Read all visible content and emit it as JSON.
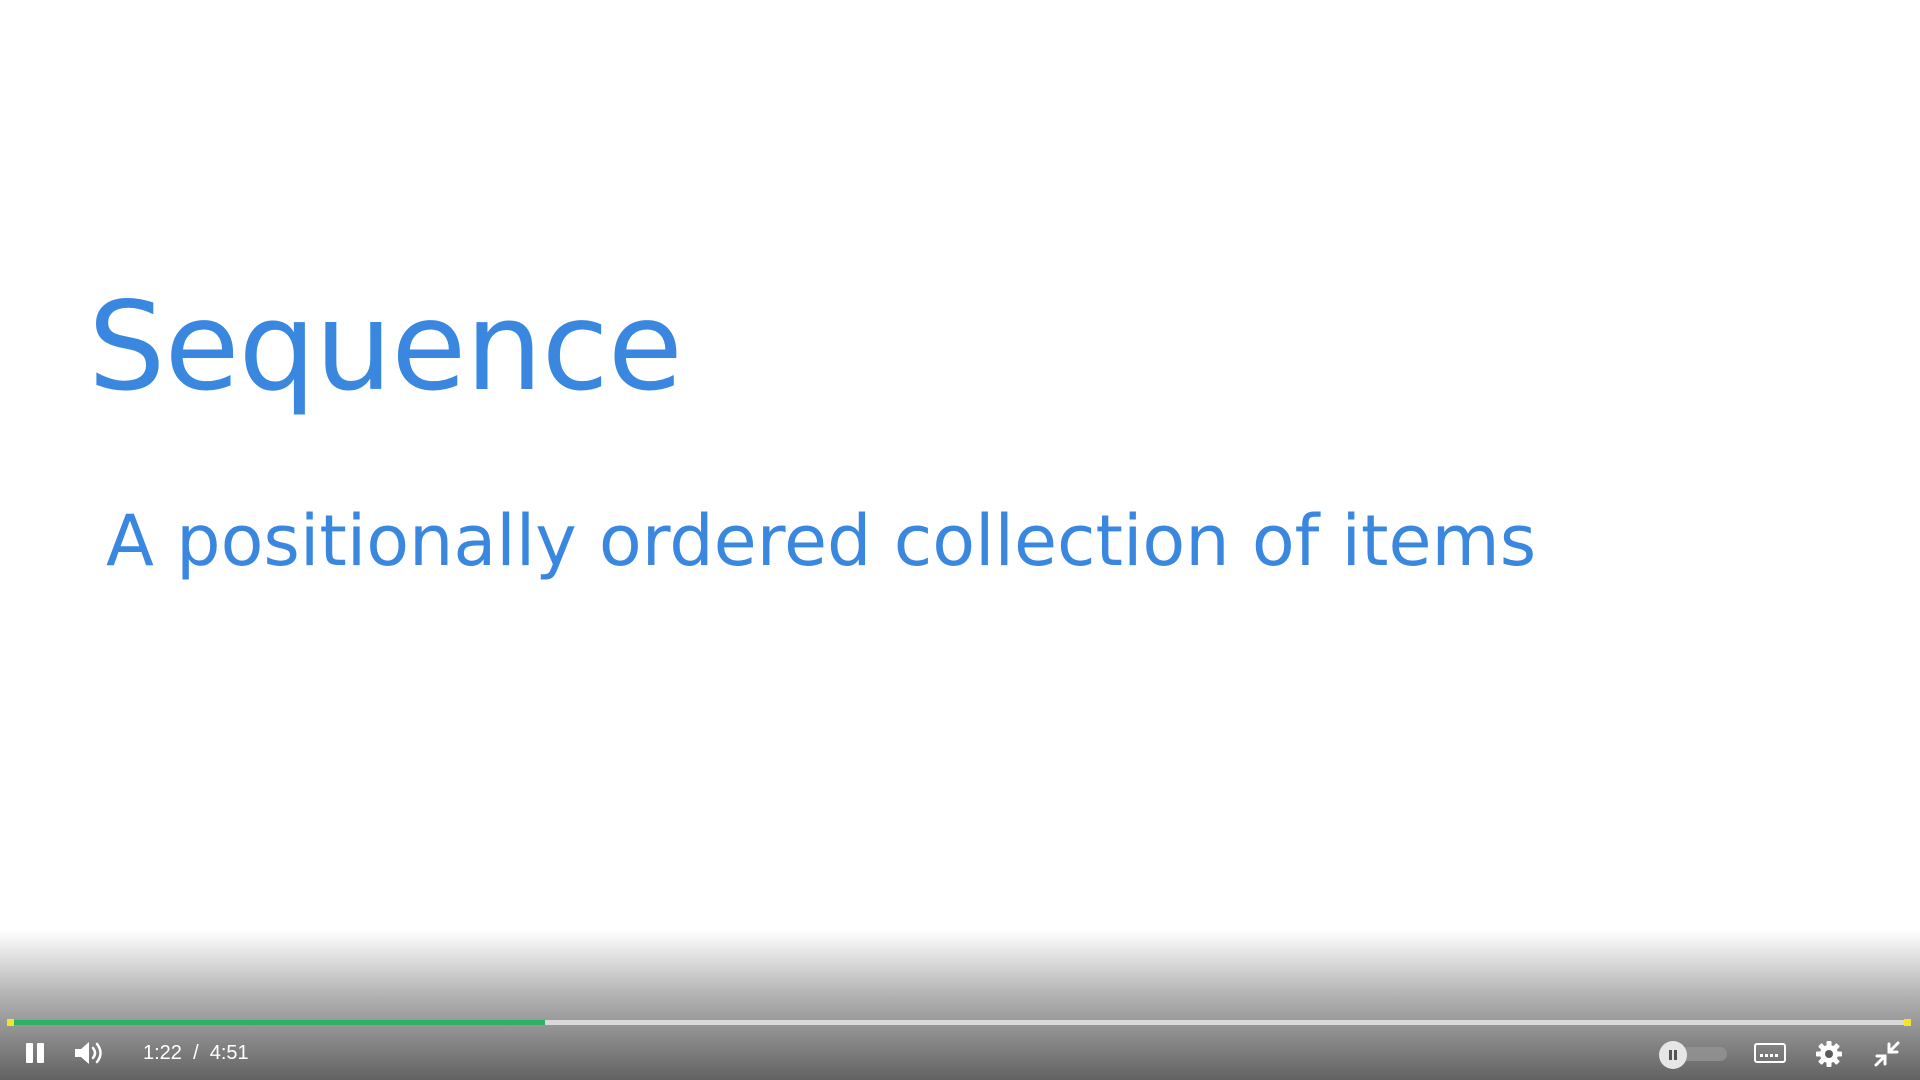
{
  "slide": {
    "title": "Sequence",
    "subtitle": "A positionally ordered collection of items"
  },
  "player": {
    "current_time": "1:22",
    "separator": "/",
    "duration": "4:51",
    "progress_fraction": 0.2818,
    "icons": {
      "play_pause": "pause-icon",
      "volume": "volume-icon",
      "autoplay": "autoplay-toggle",
      "captions": "captions-icon",
      "settings": "gear-icon",
      "fullscreen": "exit-fullscreen-icon"
    },
    "colors": {
      "slide_text": "#3a87e0",
      "progress_played": "#2fb067",
      "progress_track": "#d9d9d9",
      "markers": "#f2e32b"
    }
  }
}
